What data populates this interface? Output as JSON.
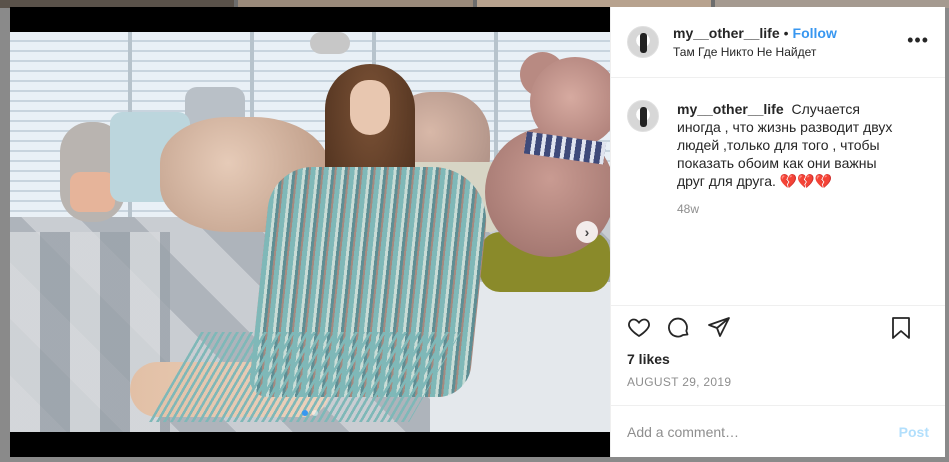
{
  "post": {
    "username": "my__other__life",
    "separator": "•",
    "follow_label": "Follow",
    "location": "Там Где Никто Не Найдет",
    "more_label": "•••",
    "caption_text": "Случается иногда , что жизнь разводит двух людей ,только для того , чтобы показать обоим как они важны друг для друга.",
    "caption_emoji": "💔💔💔",
    "caption_time": "48w",
    "likes": "7 likes",
    "date": "AUGUST 29, 2019",
    "comment_placeholder": "Add a comment…",
    "post_label": "Post"
  },
  "media": {
    "next_label": "›",
    "slides": 2,
    "active_slide": 1
  },
  "icons": {
    "like": "heart-icon",
    "comment": "comment-icon",
    "share": "share-icon",
    "save": "bookmark-icon",
    "next": "chevron-right-icon"
  },
  "colors": {
    "accent": "#3897f0",
    "post_disabled": "#b2dffc",
    "muted": "#8e8e8e",
    "text": "#262626"
  }
}
